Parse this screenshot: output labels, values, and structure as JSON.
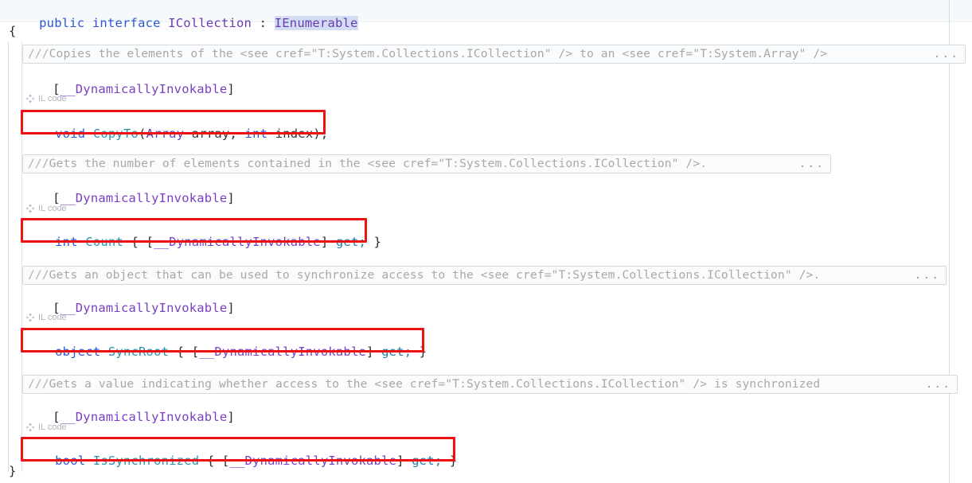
{
  "editor": {
    "declaration": {
      "keyword_public": "public",
      "keyword_interface": "interface",
      "type_name": "ICollection",
      "colon": ":",
      "base_type": "IEnumerable"
    },
    "open_brace": "{",
    "close_brace": "}",
    "codelens_label": "IL code",
    "ellipsis": "...",
    "doc_prefix": "///",
    "members": [
      {
        "doc_comment": "Copies the elements of the <see cref=\"T:System.Collections.ICollection\" /> to an <see cref=\"T:System.Array\" />",
        "attribute": "[__DynamicallyInvokable]",
        "attribute_open": "[",
        "attribute_name": "__DynamicallyInvokable",
        "attribute_close": "]",
        "signature": "void CopyTo(Array array, int index);",
        "return_type": "void",
        "member_name": "CopyTo",
        "params": "(Array array, int index);"
      },
      {
        "doc_comment": "Gets the number of elements contained in the <see cref=\"T:System.Collections.ICollection\" />.",
        "attribute": "[__DynamicallyInvokable]",
        "attribute_open": "[",
        "attribute_name": "__DynamicallyInvokable",
        "attribute_close": "]",
        "signature": "int Count { [__DynamicallyInvokable] get; }",
        "return_type": "int",
        "member_name": "Count",
        "accessor": "get;"
      },
      {
        "doc_comment": "Gets an object that can be used to synchronize access to the <see cref=\"T:System.Collections.ICollection\" />.",
        "attribute": "[__DynamicallyInvokable]",
        "attribute_open": "[",
        "attribute_name": "__DynamicallyInvokable",
        "attribute_close": "]",
        "signature": "object SyncRoot { [__DynamicallyInvokable] get; }",
        "return_type": "object",
        "member_name": "SyncRoot",
        "accessor": "get;"
      },
      {
        "doc_comment": "Gets a value indicating whether access to the <see cref=\"T:System.Collections.ICollection\" /> is synchronized",
        "attribute": "[__DynamicallyInvokable]",
        "attribute_open": "[",
        "attribute_name": "__DynamicallyInvokable",
        "attribute_close": "]",
        "signature": "bool IsSynchronized { [__DynamicallyInvokable] get; }",
        "return_type": "bool",
        "member_name": "IsSynchronized",
        "accessor": "get;"
      }
    ]
  },
  "annotations": {
    "highlight_color": "#ee1111",
    "boxes": [
      "void CopyTo(Array array, int index);",
      "int Count { [__DynamicallyInvokable] get; }",
      "object SyncRoot { [__DynamicallyInvokable] get; }",
      "bool IsSynchronized { [__DynamicallyInvokable] get; }"
    ]
  },
  "colors": {
    "keyword": "#2b56d4",
    "type_member": "#2b91af",
    "class_name": "#6a3ab2",
    "attribute": "#7a3fc4",
    "punctuation": "#2b2b2b",
    "comment": "#a8a8a8",
    "selection": "#d2ddf2",
    "codelens": "#b0b6bd"
  }
}
